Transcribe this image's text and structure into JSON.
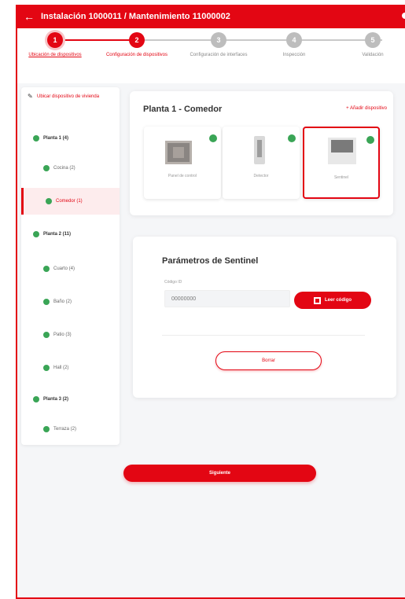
{
  "header": {
    "title": "Instalación 1000011 / Mantenimiento 11000002"
  },
  "steps": [
    {
      "number": "1",
      "label": "Ubicación de dispositivos",
      "state": "done"
    },
    {
      "number": "2",
      "label": "Configuración de dispositivos",
      "state": "active"
    },
    {
      "number": "3",
      "label": "Configuración de interfaces",
      "state": "pending"
    },
    {
      "number": "4",
      "label": "Inspección",
      "state": "pending"
    },
    {
      "number": "5",
      "label": "Validación",
      "state": "pending"
    }
  ],
  "sidebar": {
    "edit_label": "Ubicar dispositivo de vivienda",
    "items": [
      {
        "label": "Planta 1 (4)",
        "level": 1
      },
      {
        "label": "Cocina (2)",
        "level": 2
      },
      {
        "label": "Comedor (1)",
        "level": 2,
        "selected": true
      },
      {
        "label": "Planta 2 (11)",
        "level": 1
      },
      {
        "label": "Cuarto (4)",
        "level": 2
      },
      {
        "label": "Baño (2)",
        "level": 2
      },
      {
        "label": "Patio (3)",
        "level": 2
      },
      {
        "label": "Hall (2)",
        "level": 2
      },
      {
        "label": "Planta 3 (2)",
        "level": 1
      },
      {
        "label": "Terraza (2)",
        "level": 2
      }
    ]
  },
  "devices": {
    "title": "Planta 1 - Comedor",
    "link": "+ Añadir dispositivo",
    "tiles": [
      {
        "label": "Panel de control",
        "image": "control-panel",
        "selected": false
      },
      {
        "label": "Detector",
        "image": "motion-sensor",
        "selected": false
      },
      {
        "label": "Sentinel",
        "image": "sentinel",
        "selected": true
      }
    ]
  },
  "params": {
    "title": "Parámetros de Sentinel",
    "field_label": "Código ID",
    "field_value": "00000000",
    "scan_label": "Leer código",
    "outline_button": "Borrar"
  },
  "next_label": "Siguiente",
  "colors": {
    "accent": "#e30613",
    "success": "#3aa556",
    "background": "#f5f6f8"
  }
}
